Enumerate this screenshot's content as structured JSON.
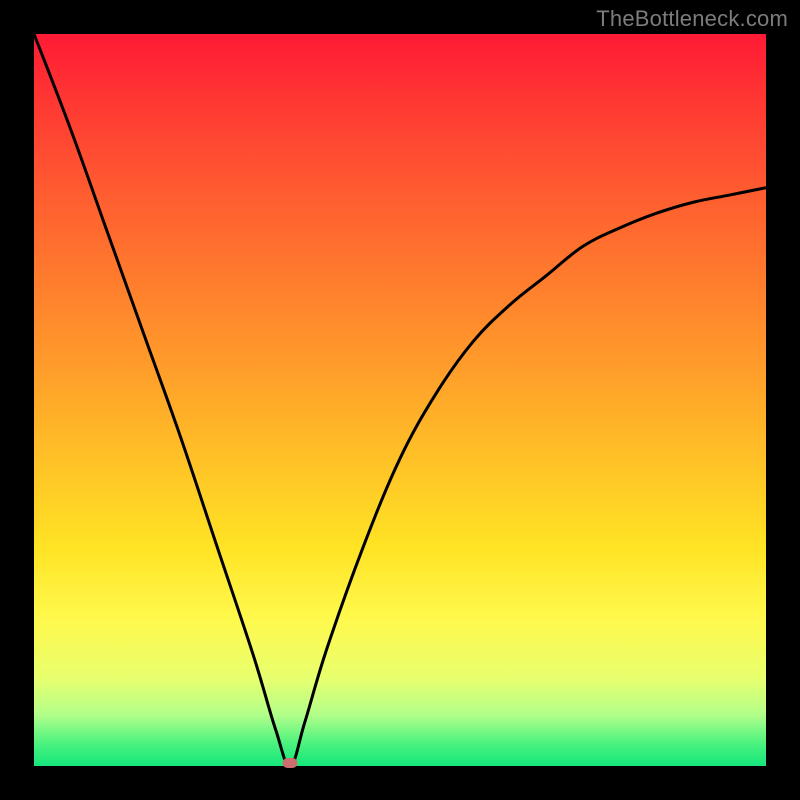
{
  "watermark": "TheBottleneck.com",
  "colors": {
    "background": "#000000",
    "gradient_top": "#ff1a35",
    "gradient_mid": "#ffe324",
    "gradient_bottom": "#15e67b",
    "curve": "#000000",
    "marker": "#cc6e6e"
  },
  "chart_data": {
    "type": "line",
    "title": "",
    "xlabel": "",
    "ylabel": "",
    "xlim": [
      0,
      100
    ],
    "ylim": [
      0,
      100
    ],
    "x_min_at": 35,
    "marker": {
      "x": 35,
      "y": 0
    },
    "series": [
      {
        "name": "bottleneck-curve",
        "x": [
          0,
          5,
          10,
          15,
          20,
          25,
          30,
          33,
          35,
          37,
          40,
          45,
          50,
          55,
          60,
          65,
          70,
          75,
          80,
          85,
          90,
          95,
          100
        ],
        "y": [
          100,
          87,
          73,
          59,
          45,
          30,
          15,
          5,
          0,
          6,
          16,
          30,
          42,
          51,
          58,
          63,
          67,
          71,
          73.5,
          75.5,
          77,
          78,
          79
        ]
      }
    ],
    "annotations": []
  }
}
